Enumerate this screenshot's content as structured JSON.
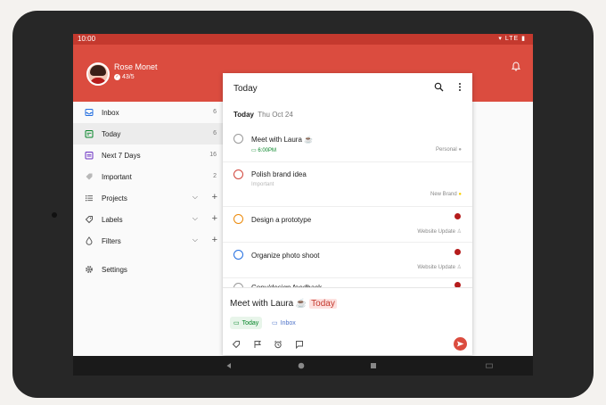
{
  "status_bar": {
    "time": "10:00",
    "network": "▾ LTE ▮"
  },
  "profile": {
    "name": "Rose Monet",
    "karma": "43/5"
  },
  "sidebar": {
    "items": [
      {
        "label": "Inbox",
        "count": "6"
      },
      {
        "label": "Today",
        "count": "6"
      },
      {
        "label": "Next 7 Days",
        "count": "16"
      },
      {
        "label": "Important",
        "count": "2"
      }
    ],
    "groups": [
      {
        "label": "Projects"
      },
      {
        "label": "Labels"
      },
      {
        "label": "Filters"
      }
    ],
    "settings_label": "Settings"
  },
  "panel": {
    "title": "Today",
    "section": {
      "day": "Today",
      "date": "Thu Oct 24"
    },
    "tasks": [
      {
        "name": "Meet with Laura ☕",
        "time": "6:00PM",
        "project": "Personal"
      },
      {
        "name": "Polish brand idea",
        "label": "Important",
        "project": "New Brand"
      },
      {
        "name": "Design a prototype",
        "project": "Website Update"
      },
      {
        "name": "Organize photo shoot",
        "project": "Website Update"
      },
      {
        "name": "Copy/design feedback"
      }
    ]
  },
  "quick_add": {
    "text": "Meet with Laura ☕",
    "highlight": "Today",
    "chip_today": "Today",
    "chip_inbox": "Inbox"
  },
  "colors": {
    "brand_red": "#db4c3f",
    "status_red": "#c4392e",
    "priority_1": "#d1453b",
    "priority_2": "#eb8909",
    "priority_3": "#246fe0",
    "today_green": "#058527"
  },
  "icons": [
    "inbox-icon",
    "calendar-today-icon",
    "calendar-week-icon",
    "tag-icon",
    "list-icon",
    "label-icon",
    "drop-icon",
    "gear-icon",
    "bell-icon",
    "search-icon",
    "more-vert-icon",
    "flag-icon",
    "alarm-icon",
    "comment-icon",
    "send-icon"
  ]
}
